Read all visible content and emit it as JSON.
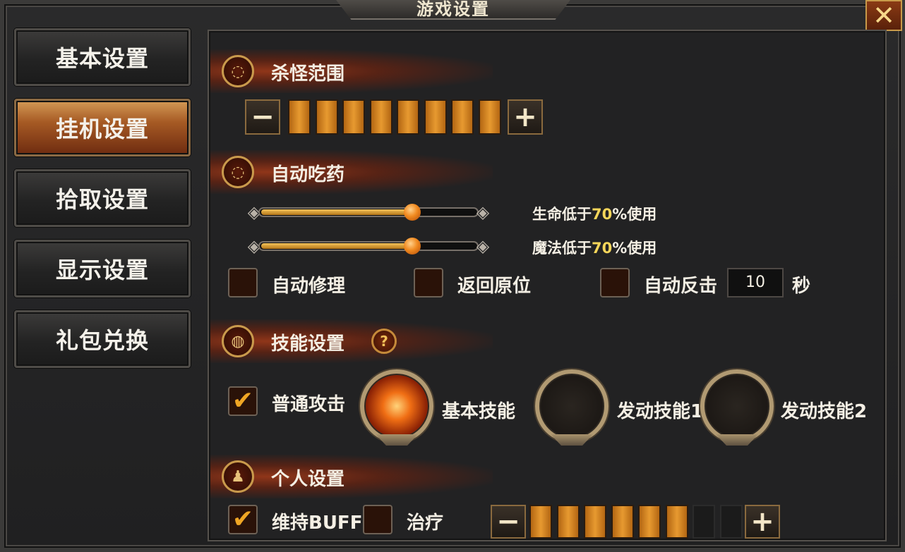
{
  "window": {
    "title": "游戏设置",
    "close_symbol": "✕"
  },
  "sidebar": {
    "items": [
      {
        "label": "基本设置",
        "active": false
      },
      {
        "label": "挂机设置",
        "active": true
      },
      {
        "label": "拾取设置",
        "active": false
      },
      {
        "label": "显示设置",
        "active": false
      },
      {
        "label": "礼包兑换",
        "active": false
      }
    ]
  },
  "sections": {
    "kill_range": {
      "title": "杀怪范围",
      "icon": "target-dots-icon",
      "minus": "−",
      "plus": "+",
      "level": 8,
      "max": 8
    },
    "auto_potion": {
      "title": "自动吃药",
      "icon": "target-dots-icon",
      "hp": {
        "prefix": "生命低于",
        "value": "70",
        "suffix": "%使用",
        "percent": 70
      },
      "mp": {
        "prefix": "魔法低于",
        "value": "70",
        "suffix": "%使用",
        "percent": 70
      },
      "options": [
        {
          "label": "自动修理",
          "checked": false
        },
        {
          "label": "返回原位",
          "checked": false
        },
        {
          "label": "自动反击",
          "checked": false
        }
      ],
      "counter_value": "10",
      "counter_unit": "秒"
    },
    "skill": {
      "title": "技能设置",
      "icon": "volleyball-icon",
      "help": "?",
      "normal_attack": {
        "label": "普通攻击",
        "checked": true
      },
      "slots": [
        {
          "label": "基本技能",
          "filled": true,
          "icon": "fire-slash-skill-icon"
        },
        {
          "label": "发动技能1",
          "filled": false
        },
        {
          "label": "发动技能2",
          "filled": false
        }
      ]
    },
    "personal": {
      "title": "个人设置",
      "icon": "person-icon",
      "buff": {
        "label": "维持BUFF",
        "checked": true
      },
      "heal": {
        "label": "治疗",
        "checked": false
      },
      "minus": "−",
      "plus": "+",
      "level": 6,
      "max": 8
    }
  },
  "colors": {
    "accent_orange": "#e79a30",
    "highlight_yellow": "#f5d65a",
    "check_orange": "#f0a624"
  }
}
